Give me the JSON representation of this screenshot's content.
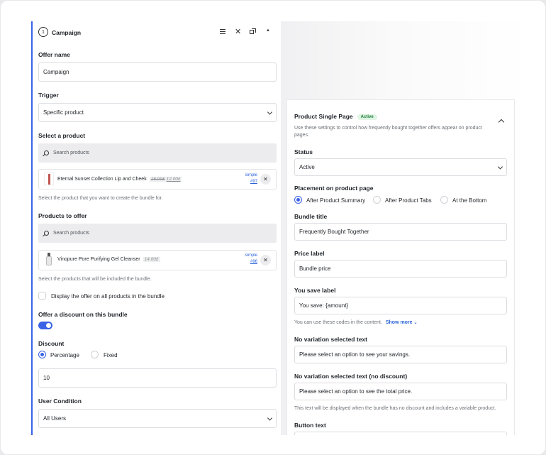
{
  "campaign": {
    "number": "1",
    "title": "Campaign",
    "offer_name_label": "Offer name",
    "offer_name_value": "Campaign",
    "trigger_label": "Trigger",
    "trigger_value": "Specific product",
    "select_product_label": "Select a product",
    "search_placeholder": "Search products",
    "selected_product": {
      "name": "Eternal Sunset Collection Lip and Cheek",
      "old_price": "16.00£",
      "new_price": "12.00£",
      "type": "simple",
      "id": "#97"
    },
    "select_product_help": "Select the product that you want to create the bundle for.",
    "products_to_offer_label": "Products to offer",
    "offer_product": {
      "name": "Vinopure Pore Purifying Gel Cleanser",
      "price": "14.00£",
      "type": "simple",
      "id": "#96"
    },
    "offer_products_help": "Select the products that will be included the bundle.",
    "display_all_label": "Display the offer on all products in the bundle",
    "offer_discount_label": "Offer a discount on this bundle",
    "discount_label": "Discount",
    "discount_options": [
      "Percentage",
      "Fixed"
    ],
    "discount_value": "10",
    "user_condition_label": "User Condition",
    "user_condition_value": "All Users"
  },
  "product_page": {
    "title": "Product Single Page",
    "badge": "Active",
    "description": "Use these settings to control how frequently bought together offers appear on product pages.",
    "status_label": "Status",
    "status_value": "Active",
    "placement_label": "Placement on product page",
    "placement_options": [
      "After Product Summary",
      "After Product Tabs",
      "At the Bottom"
    ],
    "bundle_title_label": "Bundle title",
    "bundle_title_value": "Frequently Bought Together",
    "price_label_label": "Price label",
    "price_label_value": "Bundle price",
    "you_save_label": "You save label",
    "you_save_value": "You save: {amount}",
    "codes_help": "You can use these codes in the content.",
    "show_more": "Show more",
    "no_variation_label": "No variation selected text",
    "no_variation_value": "Please select an option to see your savings.",
    "no_variation_nodisc_label": "No variation selected text (no discount)",
    "no_variation_nodisc_value": "Please select an option to see the total price.",
    "variable_help": "This text will be displayed when the bundle has no discount and includes a variable product.",
    "button_text_label": "Button text"
  },
  "colors": {
    "accent": "#3a63e6",
    "badge_bg": "#dff5e4",
    "badge_fg": "#1e7a38"
  },
  "icons": [
    "drag-handle-icon",
    "close-icon",
    "duplicate-icon",
    "collapse-icon",
    "search-icon",
    "chevron-down-icon",
    "chevron-up-icon",
    "product-thumbnail"
  ]
}
